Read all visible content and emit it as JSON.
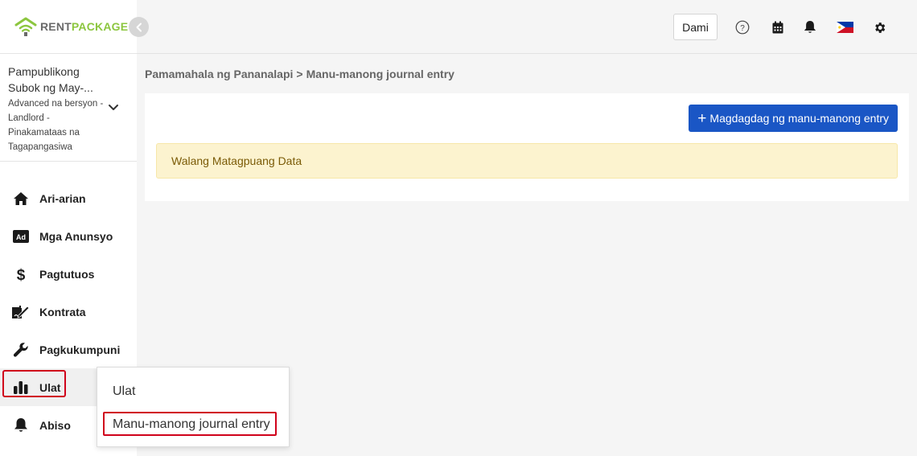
{
  "app": {
    "logo_rent": "RENT",
    "logo_package": "PACKAGE",
    "brand_color": "#8cc63f",
    "accent_color": "#1a56c5",
    "highlight_color": "#d0021b"
  },
  "account": {
    "name": "Pampublikong Subok ng May-...",
    "plan": "Advanced na bersyon - Landlord - Pinakamataas na Tagapangasiwa"
  },
  "sidebar": {
    "items": [
      {
        "label": "Ari-arian",
        "icon": "home-icon"
      },
      {
        "label": "Mga Anunsyo",
        "icon": "ad-icon"
      },
      {
        "label": "Pagtutuos",
        "icon": "dollar-icon"
      },
      {
        "label": "Kontrata",
        "icon": "signature-icon"
      },
      {
        "label": "Pagkukumpuni",
        "icon": "wrench-icon"
      },
      {
        "label": "Ulat",
        "icon": "bar-chart-icon",
        "active": true
      },
      {
        "label": "Abiso",
        "icon": "bell-icon"
      }
    ]
  },
  "topbar": {
    "dami_label": "Dami",
    "icons": [
      "help-icon",
      "calendar-icon",
      "bell-icon",
      "philippines-flag-icon",
      "gear-icon"
    ]
  },
  "breadcrumb": {
    "parent": "Pamamahala ng Pananalapi",
    "separator": ">",
    "current": "Manu-manong journal entry"
  },
  "main": {
    "add_button_label": "Magdagdag ng manu-manong entry",
    "empty_message": "Walang Matagpuang Data"
  },
  "dropdown": {
    "items": [
      "Ulat",
      "Manu-manong journal entry"
    ]
  }
}
